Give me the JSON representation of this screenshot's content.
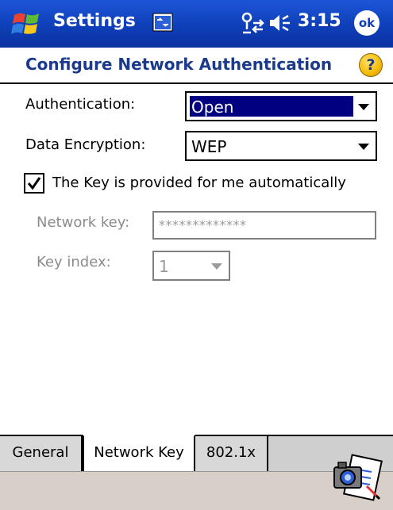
{
  "titlebar": {
    "app_title": "Settings",
    "time": "3:15",
    "ok_label": "ok",
    "start_icon": "windows-flag-icon",
    "app_icon": "settings-panel-icon",
    "connectivity_icon": "connectivity-icon",
    "volume_icon": "speaker-icon"
  },
  "page": {
    "title": "Configure Network Authentication",
    "help_label": "?"
  },
  "form": {
    "authentication_label": "Authentication:",
    "authentication_value": "Open",
    "encryption_label": "Data Encryption:",
    "encryption_value": "WEP",
    "auto_key_label": "The Key is provided for me automatically",
    "auto_key_checked": true,
    "network_key_label": "Network key:",
    "network_key_value": "*************",
    "key_index_label": "Key index:",
    "key_index_value": "1"
  },
  "tabs": [
    {
      "label": "General",
      "active": false
    },
    {
      "label": "Network Key",
      "active": true
    },
    {
      "label": "802.1x",
      "active": false
    }
  ],
  "colors": {
    "titlebar": "#0f3fb8",
    "page_title": "#1b3a8c",
    "selection": "#000080",
    "disabled_text": "#8c8c8c"
  }
}
